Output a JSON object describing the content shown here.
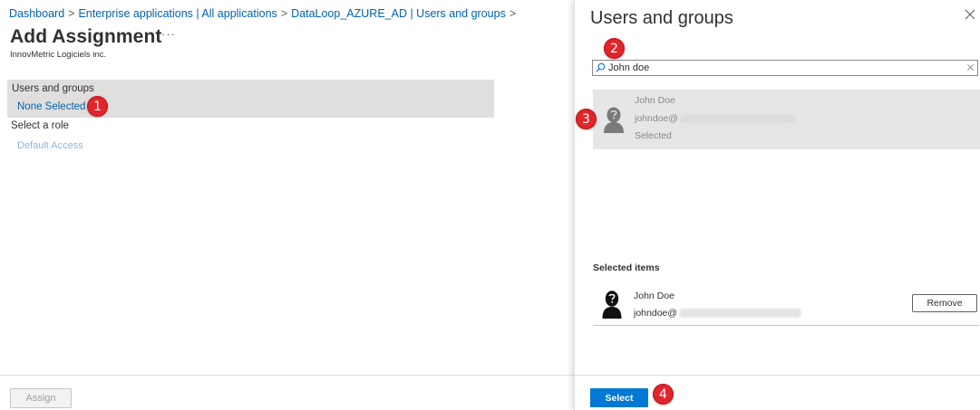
{
  "breadcrumb": {
    "items": [
      "Dashboard",
      "Enterprise applications | All applications",
      "DataLoop_AZURE_AD | Users and groups"
    ],
    "separator": ">"
  },
  "page": {
    "title": "Add Assignment",
    "more": "···",
    "tenant": "InnovMetric Logiciels inc."
  },
  "assignment": {
    "users_label": "Users and groups",
    "users_value": "None Selected",
    "role_label": "Select a role",
    "role_value": "Default Access",
    "assign_label": "Assign"
  },
  "panel": {
    "title": "Users and groups",
    "search_value": "John doe",
    "results": [
      {
        "name": "John Doe",
        "email_prefix": "johndoe@",
        "status": "Selected"
      }
    ],
    "selected_heading": "Selected items",
    "selected_items": [
      {
        "name": "John Doe",
        "email_prefix": "johndoe@",
        "remove_label": "Remove"
      }
    ],
    "select_label": "Select"
  },
  "badges": [
    "1",
    "2",
    "3",
    "4"
  ],
  "colors": {
    "link": "#0062ad",
    "primary": "#0078d4",
    "badge": "#e0262c",
    "selected_bg": "#e1dfdd"
  },
  "icons": [
    "more-icon",
    "close-icon",
    "search-icon",
    "clear-icon",
    "user-avatar-icon"
  ]
}
